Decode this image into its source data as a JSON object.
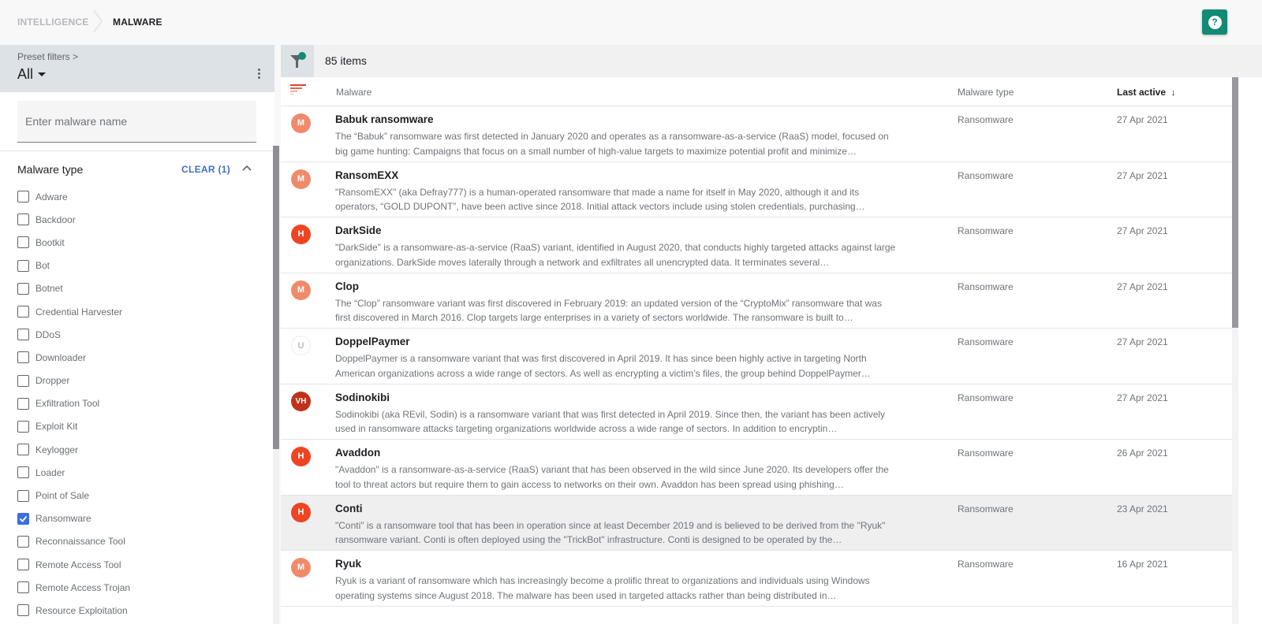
{
  "breadcrumb": {
    "parent": "INTELLIGENCE",
    "current": "MALWARE"
  },
  "help": {
    "icon": "help-icon",
    "glyph": "?"
  },
  "sidebar": {
    "preset_label": "Preset filters >",
    "preset_value": "All",
    "search_placeholder": "Enter malware name",
    "search_value": "",
    "facet_title": "Malware type",
    "clear_label": "CLEAR (1)",
    "types": [
      {
        "label": "Adware",
        "checked": false
      },
      {
        "label": "Backdoor",
        "checked": false
      },
      {
        "label": "Bootkit",
        "checked": false
      },
      {
        "label": "Bot",
        "checked": false
      },
      {
        "label": "Botnet",
        "checked": false
      },
      {
        "label": "Credential Harvester",
        "checked": false
      },
      {
        "label": "DDoS",
        "checked": false
      },
      {
        "label": "Downloader",
        "checked": false
      },
      {
        "label": "Dropper",
        "checked": false
      },
      {
        "label": "Exfiltration Tool",
        "checked": false
      },
      {
        "label": "Exploit Kit",
        "checked": false
      },
      {
        "label": "Keylogger",
        "checked": false
      },
      {
        "label": "Loader",
        "checked": false
      },
      {
        "label": "Point of Sale",
        "checked": false
      },
      {
        "label": "Ransomware",
        "checked": true
      },
      {
        "label": "Reconnaissance Tool",
        "checked": false
      },
      {
        "label": "Remote Access Tool",
        "checked": false
      },
      {
        "label": "Remote Access Trojan",
        "checked": false
      },
      {
        "label": "Resource Exploitation",
        "checked": false
      }
    ]
  },
  "main": {
    "items_count": "85 items",
    "columns": {
      "malware": "Malware",
      "type": "Malware type",
      "last_active": "Last active",
      "sort_indicator": "↓"
    },
    "rows": [
      {
        "avatar": "M",
        "name": "Babuk ransomware",
        "desc": "The “Babuk” ransomware was first detected in January 2020 and operates as a ransomware-as-a-service (RaaS) model, focused on big game hunting: Campaigns that focus on a small number of high-value targets to maximize potential profit and minimize…",
        "type": "Ransomware",
        "date": "27 Apr 2021",
        "highlighted": false
      },
      {
        "avatar": "M",
        "name": "RansomEXX",
        "desc": "\"RansomEXX\" (aka Defray777) is a human-operated ransomware that made a name for itself in May 2020, although it and its operators, “GOLD DUPONT”, have been active since 2018. Initial attack vectors include using stolen credentials, purchasing…",
        "type": "Ransomware",
        "date": "27 Apr 2021",
        "highlighted": false
      },
      {
        "avatar": "H",
        "name": "DarkSide",
        "desc": "\"DarkSide\" is a ransomware-as-a-service (RaaS) variant, identified in August 2020, that conducts highly targeted attacks against large organizations. DarkSide moves laterally through a network and exfiltrates all unencrypted data. It terminates several…",
        "type": "Ransomware",
        "date": "27 Apr 2021",
        "highlighted": false
      },
      {
        "avatar": "M",
        "name": "Clop",
        "desc": "The “Clop” ransomware variant was first discovered in February 2019: an updated version of the “CryptoMix” ransomware that was first discovered in March 2016. Clop targets large enterprises in a variety of sectors worldwide. The ransomware is built to…",
        "type": "Ransomware",
        "date": "27 Apr 2021",
        "highlighted": false
      },
      {
        "avatar": "U",
        "name": "DoppelPaymer",
        "desc": "DoppelPaymer is a ransomware variant that was first discovered in April 2019. It has since been highly active in targeting North American organizations across a wide range of sectors. As well as encrypting a victim’s files, the group behind DoppelPaymer…",
        "type": "Ransomware",
        "date": "27 Apr 2021",
        "highlighted": false
      },
      {
        "avatar": "VH",
        "name": "Sodinokibi",
        "desc": "Sodinokibi (aka REvil, Sodin) is a ransomware variant that was first detected in April 2019. Since then, the variant has been actively used in ransomware attacks targeting organizations worldwide across a wide range of sectors. In addition to encryptin…",
        "type": "Ransomware",
        "date": "27 Apr 2021",
        "highlighted": false
      },
      {
        "avatar": "H",
        "name": "Avaddon",
        "desc": "\"Avaddon\" is a ransomware-as-a-service (RaaS) variant that has been observed in the wild since June 2020. Its developers offer the tool to threat actors but require them to gain access to networks on their own. Avaddon has been spread using phishing…",
        "type": "Ransomware",
        "date": "26 Apr 2021",
        "highlighted": false
      },
      {
        "avatar": "H",
        "name": "Conti",
        "desc": "\"Conti\" is a ransomware tool that has been in operation since at least December 2019 and is believed to be derived from the \"Ryuk\" ransomware variant. Conti is often deployed using the \"TrickBot\" infrastructure. Conti is designed to be operated by the…",
        "type": "Ransomware",
        "date": "23 Apr 2021",
        "highlighted": true
      },
      {
        "avatar": "M",
        "name": "Ryuk",
        "desc": "Ryuk is a variant of ransomware which has increasingly become a prolific threat to organizations and individuals using Windows operating systems since August 2018. The malware has been used in targeted attacks rather than being distributed in…",
        "type": "Ransomware",
        "date": "16 Apr 2021",
        "highlighted": false
      }
    ]
  },
  "colors": {
    "accent_green": "#138a74",
    "link_blue": "#3f6fc6",
    "checkbox_blue": "#3b6ee0",
    "severity_M": "#f18a6b",
    "severity_H": "#ee4422",
    "severity_VH": "#c0311a",
    "severity_U": "#ffffff"
  }
}
